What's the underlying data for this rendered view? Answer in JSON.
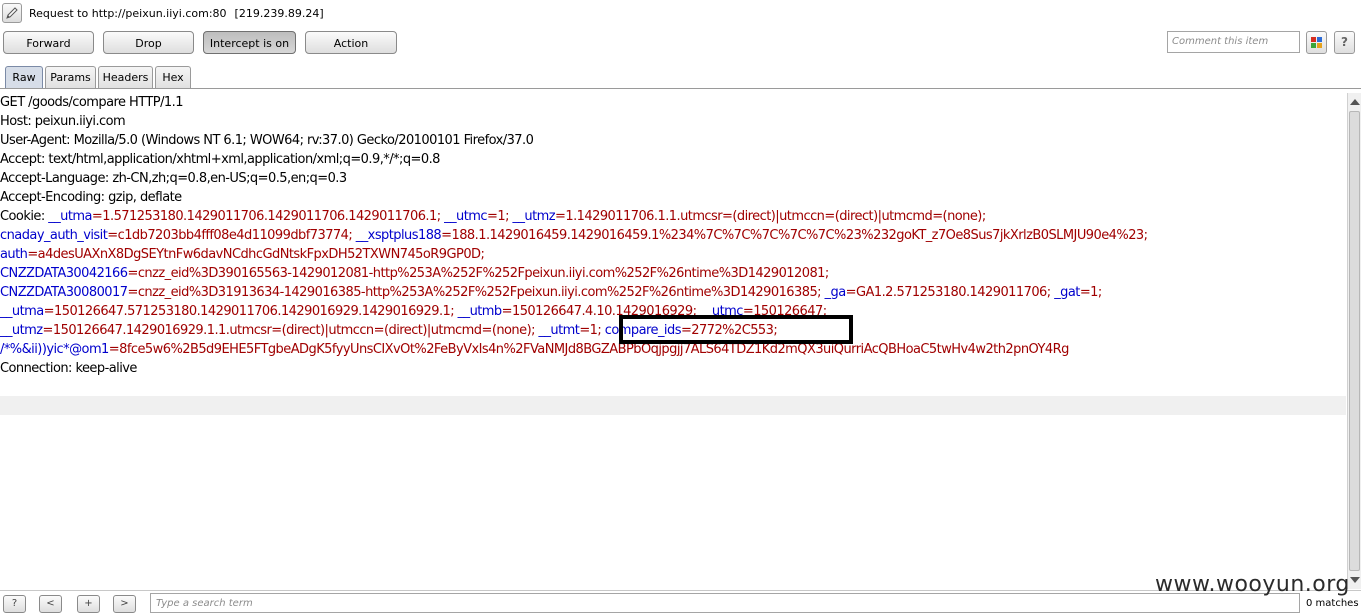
{
  "request_bar": {
    "label": "Request to http://peixun.iiyi.com:80",
    "ip": "[219.239.89.24]"
  },
  "toolbar": {
    "forward_label": "Forward",
    "drop_label": "Drop",
    "intercept_label": "Intercept is on",
    "action_label": "Action",
    "comment_placeholder": "Comment this item",
    "help_label": "?"
  },
  "tabs": [
    "Raw",
    "Params",
    "Headers",
    "Hex"
  ],
  "request_lines": [
    [
      {
        "t": "GET /goods/compare HTTP/1.1",
        "c": ""
      }
    ],
    [
      {
        "t": "Host: peixun.iiyi.com",
        "c": ""
      }
    ],
    [
      {
        "t": "User-Agent: Mozilla/5.0 (Windows NT 6.1; WOW64; rv:37.0) Gecko/20100101 Firefox/37.0",
        "c": ""
      }
    ],
    [
      {
        "t": "Accept: text/html,application/xhtml+xml,application/xml;q=0.9,*/*;q=0.8",
        "c": ""
      }
    ],
    [
      {
        "t": "Accept-Language: zh-CN,zh;q=0.8,en-US;q=0.5,en;q=0.3",
        "c": ""
      }
    ],
    [
      {
        "t": "Accept-Encoding: gzip, deflate",
        "c": ""
      }
    ],
    [
      {
        "t": "Cookie: ",
        "c": ""
      },
      {
        "t": "__utma",
        "c": "k"
      },
      {
        "t": "=1.571253180.1429011706.1429011706.1429011706.1; ",
        "c": "v"
      },
      {
        "t": "__utmc",
        "c": "k"
      },
      {
        "t": "=1; ",
        "c": "v"
      },
      {
        "t": "__utmz",
        "c": "k"
      },
      {
        "t": "=1.1429011706.1.1.utmcsr=(direct)|utmccn=(direct)|utmcmd=(none);",
        "c": "v"
      }
    ],
    [
      {
        "t": "cnaday_auth_visit",
        "c": "k"
      },
      {
        "t": "=c1db7203bb4fff08e4d11099dbf73774; ",
        "c": "v"
      },
      {
        "t": "__xsptplus188",
        "c": "k"
      },
      {
        "t": "=188.1.1429016459.1429016459.1%234%7C%7C%7C%7C%7C%23%232goKT_z7Oe8Sus7jkXrlzB0SLMJU90e4%23;",
        "c": "v"
      }
    ],
    [
      {
        "t": "auth",
        "c": "k"
      },
      {
        "t": "=a4desUAXnX8DgSEYtnFw6davNCdhcGdNtskFpxDH52TXWN745oR9GP0D;",
        "c": "v"
      }
    ],
    [
      {
        "t": "CNZZDATA30042166",
        "c": "k"
      },
      {
        "t": "=cnzz_eid%3D390165563-1429012081-http%253A%252F%252Fpeixun.iiyi.com%252F%26ntime%3D1429012081;",
        "c": "v"
      }
    ],
    [
      {
        "t": "CNZZDATA30080017",
        "c": "k"
      },
      {
        "t": "=cnzz_eid%3D31913634-1429016385-http%253A%252F%252Fpeixun.iiyi.com%252F%26ntime%3D1429016385; ",
        "c": "v"
      },
      {
        "t": "_ga",
        "c": "k"
      },
      {
        "t": "=GA1.2.571253180.1429011706; ",
        "c": "v"
      },
      {
        "t": "_gat",
        "c": "k"
      },
      {
        "t": "=1;",
        "c": "v"
      }
    ],
    [
      {
        "t": "__utma",
        "c": "k"
      },
      {
        "t": "=150126647.571253180.1429011706.1429016929.1429016929.1; ",
        "c": "v"
      },
      {
        "t": "__utmb",
        "c": "k"
      },
      {
        "t": "=150126647.4.10.1429016929; ",
        "c": "v"
      },
      {
        "t": "__utmc",
        "c": "k"
      },
      {
        "t": "=150126647;",
        "c": "v"
      }
    ],
    [
      {
        "t": "__utmz",
        "c": "k"
      },
      {
        "t": "=150126647.1429016929.1.1.utmcsr=(direct)|utmccn=(direct)|utmcmd=(none); ",
        "c": "v"
      },
      {
        "t": "__utmt",
        "c": "k"
      },
      {
        "t": "=1; ",
        "c": "v"
      },
      {
        "t": "compare_ids",
        "c": "k"
      },
      {
        "t": "=2772%2C553;",
        "c": "v"
      }
    ],
    [
      {
        "t": "/*%&ii))yic*@om1",
        "c": "k"
      },
      {
        "t": "=8fce5w6%2B5d9EHE5FTgbeADgK5fyyUnsCIXvOt%2FeByVxIs4n%2FVaNMJd8BGZABPbOqjpgjj7ALS64TDZ1Kd2mQX3uiQurriAcQBHoaC5twHv4w2th2pnOY4Rg",
        "c": "v"
      }
    ],
    [
      {
        "t": "Connection: keep-alive",
        "c": ""
      }
    ]
  ],
  "search": {
    "help_label": "?",
    "prev_label": "<",
    "add_label": "+",
    "next_label": ">",
    "placeholder": "Type a search term",
    "matches": "0 matches"
  },
  "watermark": "www.wooyun.org",
  "colors": {
    "key_blue": "#0000cc",
    "value_red": "#a00000",
    "highlight_border": "#000000"
  }
}
